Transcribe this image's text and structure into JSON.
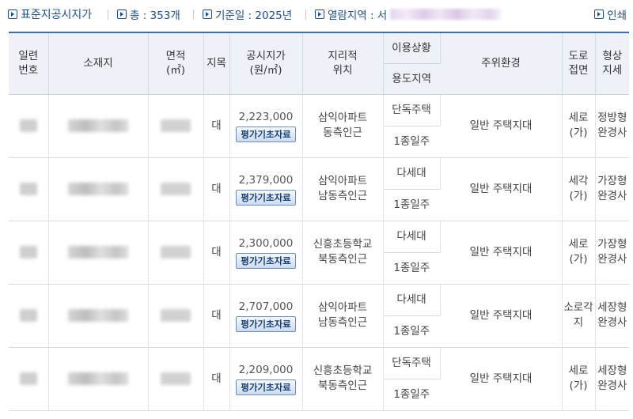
{
  "topbar": {
    "title": "표준지공시지가",
    "total": "총 : 353개",
    "base_date": "기준일 : 2025년",
    "region_label": "열람지역 : 서",
    "print_label": "인쇄"
  },
  "columns": {
    "serial": "일련\n번호",
    "location": "소재지",
    "area": "면적\n(㎡)",
    "land_category": "지목",
    "price": "공시지가\n(원/㎡)",
    "geo_position": "지리적\n위치",
    "land_use": "이용상황",
    "zoning": "용도지역",
    "surroundings": "주위환경",
    "road_access": "도로\n접면",
    "shape": "형상\n지세"
  },
  "rows": [
    {
      "land_category": "대",
      "price": "2,223,000",
      "eval_button": "평가기초자료",
      "geo_position": "삼익아파트\n동측인근",
      "land_use": "단독주택",
      "zoning": "1종일주",
      "surroundings": "일반 주택지대",
      "road_access": "세로\n(가)",
      "shape": "정방형\n완경사"
    },
    {
      "land_category": "대",
      "price": "2,379,000",
      "eval_button": "평가기초자료",
      "geo_position": "삼익아파트\n남동측인근",
      "land_use": "다세대",
      "zoning": "1종일주",
      "surroundings": "일반 주택지대",
      "road_access": "세각\n(가)",
      "shape": "가장형\n완경사"
    },
    {
      "land_category": "대",
      "price": "2,300,000",
      "eval_button": "평가기초자료",
      "geo_position": "신흥초등학교\n북동측인근",
      "land_use": "다세대",
      "zoning": "1종일주",
      "surroundings": "일반 주택지대",
      "road_access": "세로\n(가)",
      "shape": "가장형\n완경사"
    },
    {
      "land_category": "대",
      "price": "2,707,000",
      "eval_button": "평가기초자료",
      "geo_position": "삼익아파트\n남동측인근",
      "land_use": "다세대",
      "zoning": "1종일주",
      "surroundings": "일반 주택지대",
      "road_access": "소로각\n지",
      "shape": "세장형\n완경사"
    },
    {
      "land_category": "대",
      "price": "2,209,000",
      "eval_button": "평가기초자료",
      "geo_position": "신흥초등학교\n북동측인근",
      "land_use": "단독주택",
      "zoning": "1종일주",
      "surroundings": "일반 주택지대",
      "road_access": "세로\n(가)",
      "shape": "세장형\n완경사"
    }
  ]
}
